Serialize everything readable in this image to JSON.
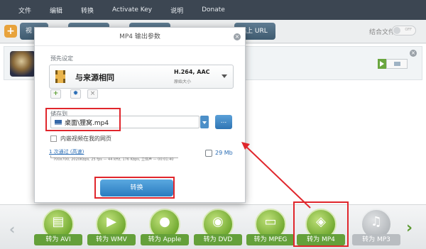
{
  "menu": {
    "items": [
      "文件",
      "编辑",
      "转换",
      "Activate Key",
      "说明",
      "Donate"
    ]
  },
  "toolbar": {
    "buttons": [
      "视",
      "",
      "",
      "粘上 URL"
    ],
    "merge_label": "结合文件",
    "merge_toggle": "OFF"
  },
  "dialog": {
    "title": "MP4 输出参数",
    "preset_label": "预先设定",
    "preset_name": "与来源相同",
    "preset_codec": "H.264, AAC",
    "preset_size": "原始大小",
    "save_label": "储存到",
    "save_path": "桌面\\狸窝.mp4",
    "browse_label": "...",
    "embed_label": "内嵌视频在我的网页",
    "pass_label": "1 次通过 (高速)",
    "pass_info": "700x700, 2020Kbps, 25 fps — 44 kHz, 176 Kbps, 立体声 — 00:01:40",
    "output_size": "29 Mb",
    "convert_label": "转换"
  },
  "converters": [
    {
      "label": "转为 AVI",
      "icon": "film-icon",
      "active": true
    },
    {
      "label": "转为 WMV",
      "icon": "media-icon",
      "active": true
    },
    {
      "label": "转为 Apple",
      "icon": "apple-icon",
      "active": true
    },
    {
      "label": "转为 DVD",
      "icon": "disc-icon",
      "active": true
    },
    {
      "label": "转为 MPEG",
      "icon": "tv-icon",
      "active": true
    },
    {
      "label": "转为 MP4",
      "icon": "mp4-icon",
      "active": true
    },
    {
      "label": "转为 MP3",
      "icon": "audio-icon",
      "active": false
    }
  ],
  "colors": {
    "accent": "#64a03a",
    "highlight": "#e0262c",
    "header": "#3c4652"
  }
}
